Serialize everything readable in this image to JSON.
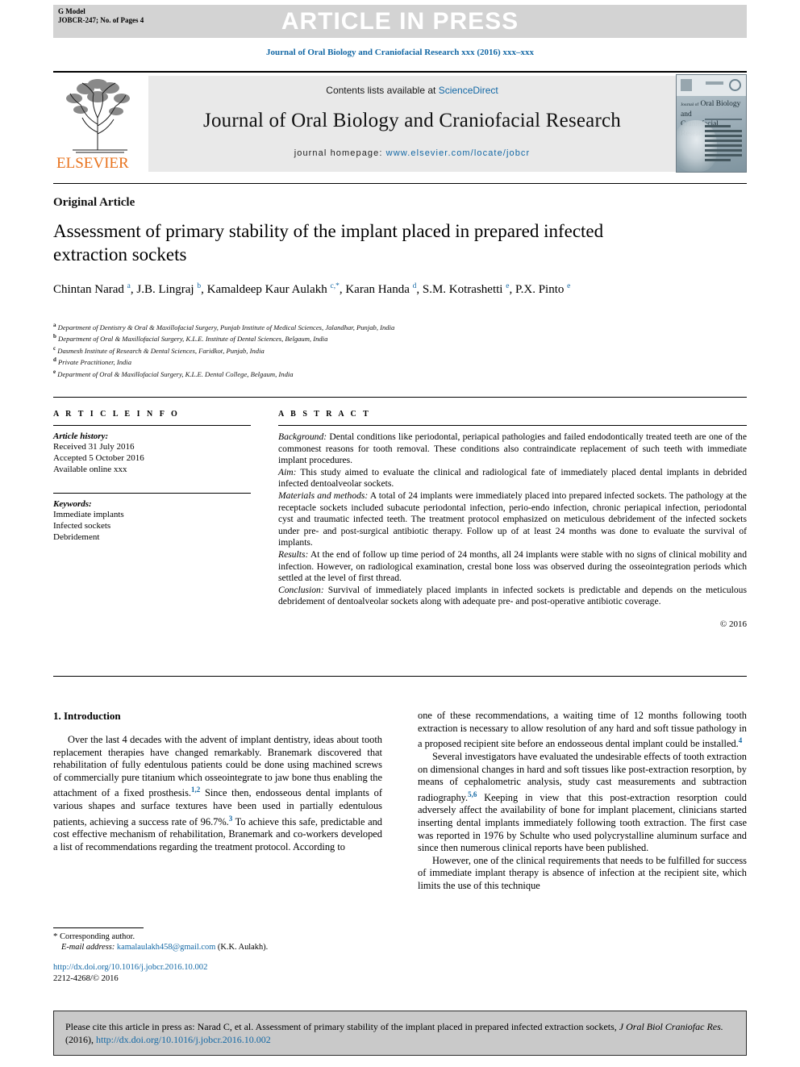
{
  "banner": {
    "model_label": "G Model\nJOBCR-247; No. of Pages 4",
    "title": "ARTICLE IN PRESS"
  },
  "running_head": "Journal of Oral Biology and Craniofacial Research xxx (2016) xxx–xxx",
  "masthead": {
    "contents_prefix": "Contents lists available at ",
    "sciencedirect": "ScienceDirect",
    "journal_name": "Journal of Oral Biology and Craniofacial Research",
    "homepage_label": "journal homepage: ",
    "homepage_url": "www.elsevier.com/locate/jobcr",
    "publisher": "ELSEVIER",
    "cover_title_small": "Journal of",
    "cover_title_line1": "Oral Biology and",
    "cover_title_line2": "Craniofacial Research"
  },
  "article": {
    "type": "Original Article",
    "title": "Assessment of primary stability of the implant placed in prepared infected extraction sockets",
    "authors_html": "Chintan Narad <sup>a</sup>, J.B. Lingraj <sup>b</sup>, Kamaldeep Kaur Aulakh <sup>c,*</sup>, Karan Handa <sup>d</sup>, S.M. Kotrashetti <sup>e</sup>, P.X. Pinto <sup>e</sup>",
    "affiliations": [
      {
        "mark": "a",
        "text": "Department of Dentistry & Oral & Maxillofacial Surgery, Punjab Institute of Medical Sciences, Jalandhar, Punjab, India"
      },
      {
        "mark": "b",
        "text": "Department of Oral & Maxillofacial Surgery, K.L.E. Institute of Dental Sciences, Belgaum, India"
      },
      {
        "mark": "c",
        "text": "Dasmesh Institute of Research & Dental Sciences, Faridkot, Punjab, India"
      },
      {
        "mark": "d",
        "text": "Private Practitioner, India"
      },
      {
        "mark": "e",
        "text": "Department of Oral & Maxillofacial Surgery, K.L.E. Dental College, Belgaum, India"
      }
    ]
  },
  "article_info": {
    "heading": "A R T I C L E  I N F O",
    "history_label": "Article history:",
    "history": [
      "Received 31 July 2016",
      "Accepted 5 October 2016",
      "Available online xxx"
    ],
    "keywords_label": "Keywords:",
    "keywords": [
      "Immediate implants",
      "Infected sockets",
      "Debridement"
    ]
  },
  "abstract": {
    "heading": "A B S T R A C T",
    "sections": [
      {
        "label": "Background:",
        "text": " Dental conditions like periodontal, periapical pathologies and failed endodontically treated teeth are one of the commonest reasons for tooth removal. These conditions also contraindicate replacement of such teeth with immediate implant procedures."
      },
      {
        "label": "Aim:",
        "text": " This study aimed to evaluate the clinical and radiological fate of immediately placed dental implants in debrided infected dentoalveolar sockets."
      },
      {
        "label": "Materials and methods:",
        "text": " A total of 24 implants were immediately placed into prepared infected sockets. The pathology at the receptacle sockets included subacute periodontal infection, perio-endo infection, chronic periapical infection, periodontal cyst and traumatic infected teeth. The treatment protocol emphasized on meticulous debridement of the infected sockets under pre- and post-surgical antibiotic therapy. Follow up of at least 24 months was done to evaluate the survival of implants."
      },
      {
        "label": "Results:",
        "text": " At the end of follow up time period of 24 months, all 24 implants were stable with no signs of clinical mobility and infection. However, on radiological examination, crestal bone loss was observed during the osseointegration periods which settled at the level of first thread."
      },
      {
        "label": "Conclusion:",
        "text": " Survival of immediately placed implants in infected sockets is predictable and depends on the meticulous debridement of dentoalveolar sockets along with adequate pre- and post-operative antibiotic coverage."
      }
    ],
    "copyright": "© 2016"
  },
  "body": {
    "section_heading": "1. Introduction",
    "left_paragraphs": [
      "Over the last 4 decades with the advent of implant dentistry, ideas about tooth replacement therapies have changed remarkably. Branemark discovered that rehabilitation of fully edentulous patients could be done using machined screws of commercially pure titanium which osseointegrate to jaw bone thus enabling the attachment of a fixed prosthesis.<sup>1,2</sup> Since then, endosseous dental implants of various shapes and surface textures have been used in partially edentulous patients, achieving a success rate of 96.7%.<sup>3</sup> To achieve this safe, predictable and cost effective mechanism of rehabilitation, Branemark and co-workers developed a list of recommendations regarding the treatment protocol. According to"
    ],
    "right_paragraphs": [
      "one of these recommendations, a waiting time of 12 months following tooth extraction is necessary to allow resolution of any hard and soft tissue pathology in a proposed recipient site before an endosseous dental implant could be installed.<sup>4</sup>",
      "Several investigators have evaluated the undesirable effects of tooth extraction on dimensional changes in hard and soft tissues like post-extraction resorption, by means of cephalometric analysis, study cast measurements and subtraction radiography.<sup>5,6</sup> Keeping in view that this post-extraction resorption could adversely affect the availability of bone for implant placement, clinicians started inserting dental implants immediately following tooth extraction. The first case was reported in 1976 by Schulte who used polycrystalline aluminum surface and since then numerous clinical reports have been published.",
      "However, one of the clinical requirements that needs to be fulfilled for success of immediate implant therapy is absence of infection at the recipient site, which limits the use of this technique"
    ]
  },
  "footnote": {
    "corresponding_author": "Corresponding author.",
    "email_label": "E-mail address:",
    "email": "kamalaulakh458@gmail.com",
    "email_owner": "(K.K. Aulakh).",
    "doi": "http://dx.doi.org/10.1016/j.jobcr.2016.10.002",
    "issn_line": "2212-4268/© 2016"
  },
  "cite_box": {
    "prefix": "Please cite this article in press as: Narad C, et al. Assessment of primary stability of the implant placed in prepared infected extraction sockets, ",
    "journal_abbrev": "J Oral Biol Craniofac Res.",
    "year": " (2016), ",
    "doi": "http://dx.doi.org/10.1016/j.jobcr.2016.10.002"
  },
  "colors": {
    "link_blue": "#1368a5",
    "elsevier_orange": "#e8731e",
    "banner_grey": "#d3d3d3",
    "masthead_grey": "#e9e9e9",
    "cite_grey": "#c9c9c9"
  }
}
